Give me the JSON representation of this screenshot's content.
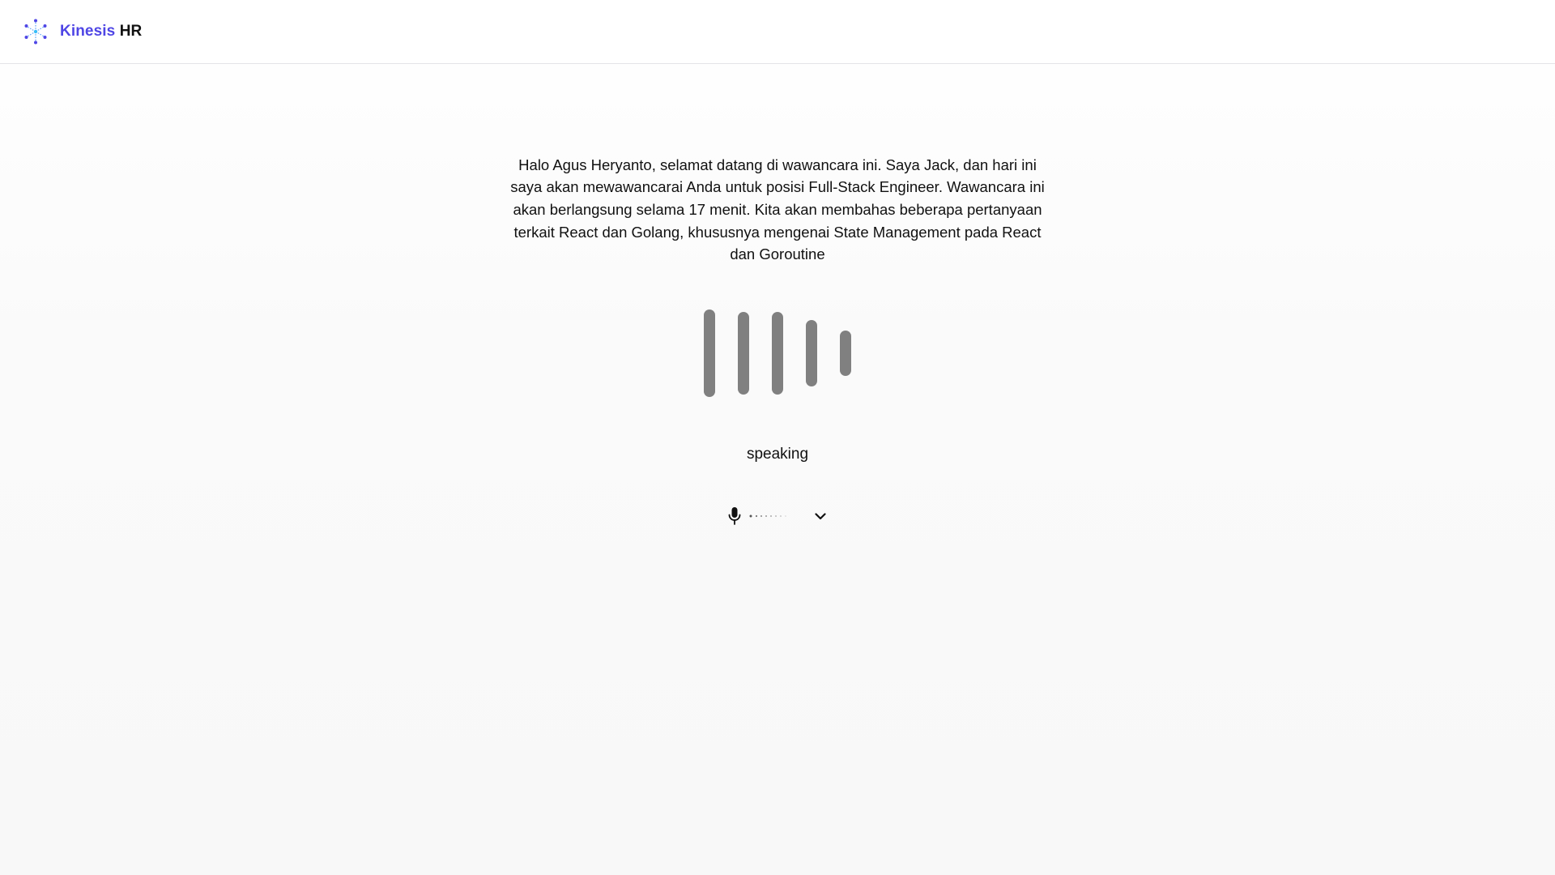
{
  "header": {
    "brand_primary": "Kinesis",
    "brand_secondary": "HR",
    "logo_icon": "sparkle-network-icon"
  },
  "main": {
    "transcript": "Halo Agus Heryanto, selamat datang di wawancara ini. Saya Jack, dan hari ini saya akan mewawancarai Anda untuk posisi Full-Stack Engineer. Wawancara ini akan berlangsung selama 17 menit. Kita akan membahas beberapa pertanyaan terkait React dan Golang, khususnya mengenai State Management pada React dan Goroutine",
    "voice_bars": [
      1.0,
      0.94,
      0.94,
      0.76,
      0.52
    ],
    "status": "speaking"
  },
  "mic_selector": {
    "icon": "microphone-icon",
    "expand_icon": "chevron-down-icon"
  },
  "colors": {
    "brand_accent": "#4f46e5",
    "bar": "#808080",
    "text": "#111111",
    "divider": "#e4e4e7"
  }
}
